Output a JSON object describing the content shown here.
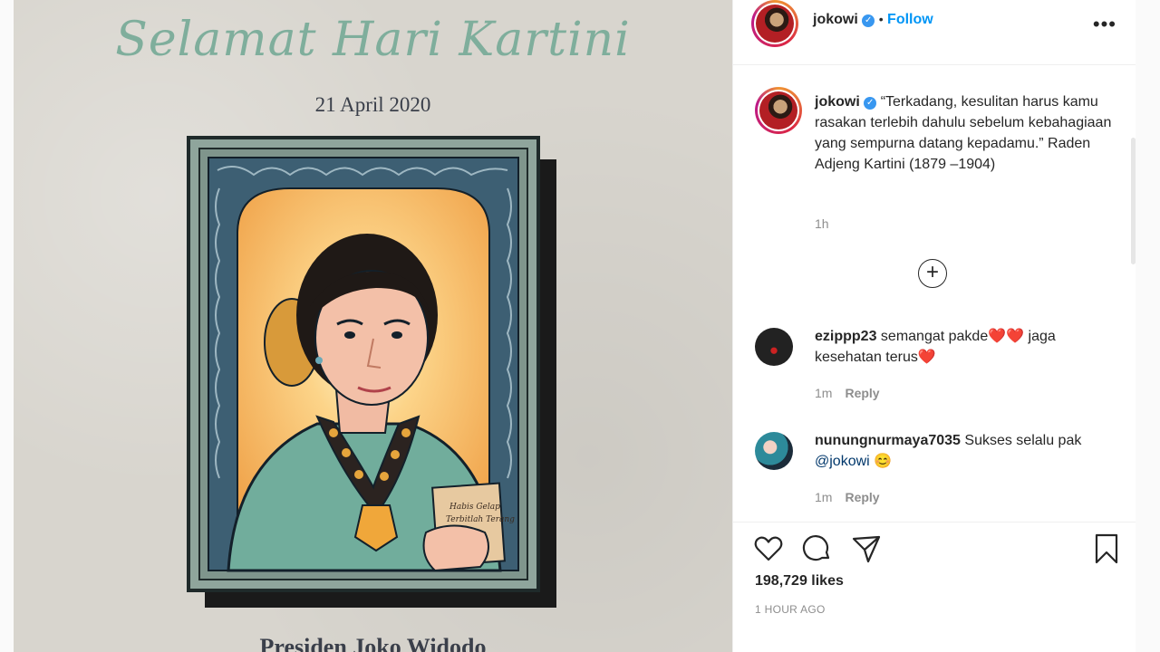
{
  "post_image": {
    "title": "Selamat Hari Kartini",
    "date": "21 April 2020",
    "footer": "Presiden Joko Widodo",
    "book_text": "Habis Gelap Terbitlah Terang"
  },
  "header": {
    "username": "jokowi",
    "verified_icon": "✓",
    "separator": "•",
    "follow_label": "Follow",
    "more_label": "•••"
  },
  "caption": {
    "username": "jokowi",
    "text": "“Terkadang, kesulitan harus kamu rasakan terlebih dahulu sebelum kebahagiaan yang sempurna datang kepadamu.” Raden Adjeng Kartini (1879 –1904)",
    "time": "1h"
  },
  "load_more_label": "+",
  "comments": [
    {
      "username": "ezippp23",
      "text_before": "semangat pakde",
      "hearts_mid": "❤️❤️",
      "text_after": " jaga kesehatan terus",
      "hearts_end": "❤️",
      "time": "1m",
      "reply_label": "Reply"
    },
    {
      "username": "nunungnurmaya7035",
      "text_before": "Sukses selalu pak ",
      "mention": "@jokowi",
      "emoji": " 😊",
      "time": "1m",
      "reply_label": "Reply"
    }
  ],
  "engagement": {
    "likes": "198,729 likes",
    "time_ago": "1 HOUR AGO"
  },
  "icons": {
    "like": "heart-icon",
    "comment": "comment-icon",
    "share": "share-icon",
    "save": "bookmark-icon"
  }
}
